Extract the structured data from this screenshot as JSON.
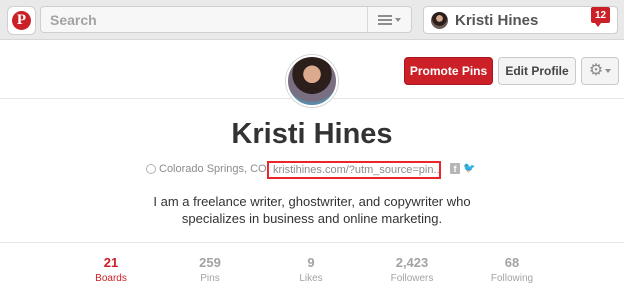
{
  "header": {
    "logo_glyph": "P",
    "logo_icon": "pinterest-logo-icon",
    "search_placeholder": "Search",
    "search_menu_icon": "hamburger-menu-icon",
    "user_name": "Kristi Hines",
    "notification_count": "12"
  },
  "actions": {
    "promote_label": "Promote Pins",
    "edit_label": "Edit Profile",
    "settings_icon": "gear-icon",
    "settings_glyph": "⚙"
  },
  "profile": {
    "name": "Kristi Hines",
    "location": "Colorado Springs, CO",
    "website": "kristihines.com/?utm_source=pin...",
    "bio_line1": "I am a freelance writer, ghostwriter, and copywriter who",
    "bio_line2": "specializes in business and online marketing.",
    "facebook_glyph": "f",
    "twitter_glyph": "🐦"
  },
  "stats": [
    {
      "value": "21",
      "label": "Boards",
      "active": true
    },
    {
      "value": "259",
      "label": "Pins",
      "active": false
    },
    {
      "value": "9",
      "label": "Likes",
      "active": false
    },
    {
      "value": "2,423",
      "label": "Followers",
      "active": false
    },
    {
      "value": "68",
      "label": "Following",
      "active": false
    }
  ],
  "colors": {
    "brand_red": "#cb2027",
    "highlight_box": "#e8262c"
  }
}
